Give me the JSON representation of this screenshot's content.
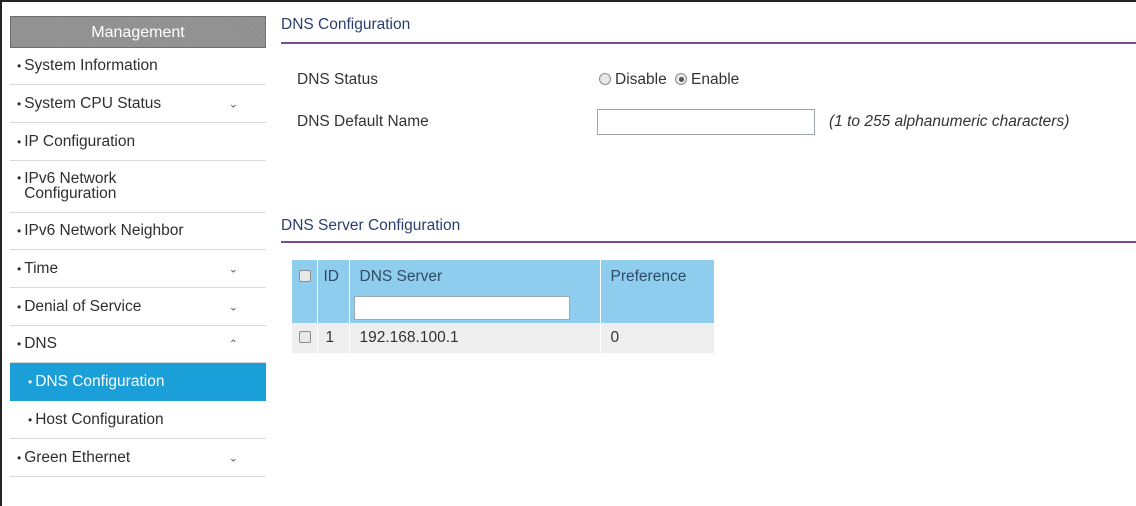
{
  "sidebar": {
    "header": "Management",
    "items": [
      {
        "label": "System Information",
        "chevron": ""
      },
      {
        "label": "System CPU Status",
        "chevron": "⌄"
      },
      {
        "label": "IP Configuration",
        "chevron": ""
      },
      {
        "label": "IPv6 Network Configuration",
        "chevron": ""
      },
      {
        "label": "IPv6 Network Neighbor",
        "chevron": ""
      },
      {
        "label": "Time",
        "chevron": "⌄"
      },
      {
        "label": "Denial of Service",
        "chevron": "⌄"
      },
      {
        "label": "DNS",
        "chevron": "⌃"
      },
      {
        "label": "DNS Configuration",
        "chevron": ""
      },
      {
        "label": "Host Configuration",
        "chevron": ""
      },
      {
        "label": "Green Ethernet",
        "chevron": "⌄"
      }
    ]
  },
  "dns_config": {
    "title": "DNS Configuration",
    "status_label": "DNS Status",
    "disable_label": "Disable",
    "enable_label": "Enable",
    "status_value": "Enable",
    "default_name_label": "DNS Default Name",
    "default_name_value": "",
    "default_name_hint": "(1 to 255 alphanumeric characters)"
  },
  "dns_server": {
    "title": "DNS Server Configuration",
    "columns": [
      "ID",
      "DNS Server",
      "Preference"
    ],
    "filter_value": "",
    "rows": [
      {
        "id": "1",
        "server": "192.168.100.1",
        "preference": "0"
      }
    ]
  },
  "colors": {
    "active_nav": "#1a9fd9",
    "table_header": "#8fcdee",
    "section_underline": "#7b4a96"
  }
}
